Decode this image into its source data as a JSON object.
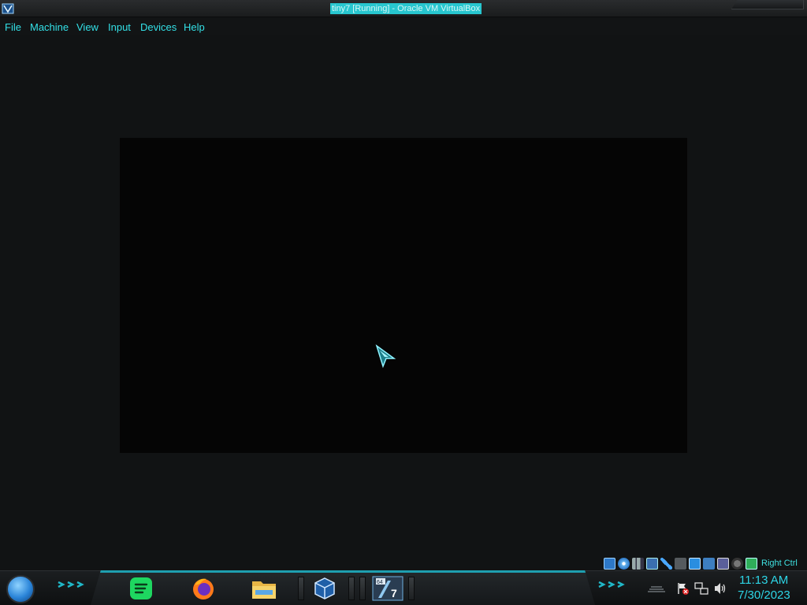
{
  "window": {
    "title": "tiny7 [Running] - Oracle VM VirtualBox"
  },
  "menu": {
    "items": [
      "File",
      "Machine",
      "View",
      "Input",
      "Devices",
      "Help"
    ]
  },
  "status_bar": {
    "icons": [
      "hard-disk-icon",
      "optical-drive-icon",
      "audio-icon",
      "network-icon",
      "usb-icon",
      "shared-folders-icon",
      "display-icon",
      "video-capture-icon",
      "cpu-virtualization-icon",
      "mouse-integration-icon",
      "keyboard-capture-icon"
    ],
    "host_key": "Right Ctrl"
  },
  "taskbar": {
    "pinned": [
      "start-orb",
      "spotify-icon",
      "firefox-icon",
      "file-explorer-icon",
      "virtualbox-icon",
      "windows7-vm-icon"
    ],
    "vm_badge": "64",
    "vm_number": "7"
  },
  "tray": {
    "time": "11:13 AM",
    "date": "7/30/2023"
  },
  "colors": {
    "accent": "#2ee6e6",
    "title_highlight": "#27c6cf",
    "desktop_bg": "#111314",
    "vm_screen": "#050505"
  }
}
